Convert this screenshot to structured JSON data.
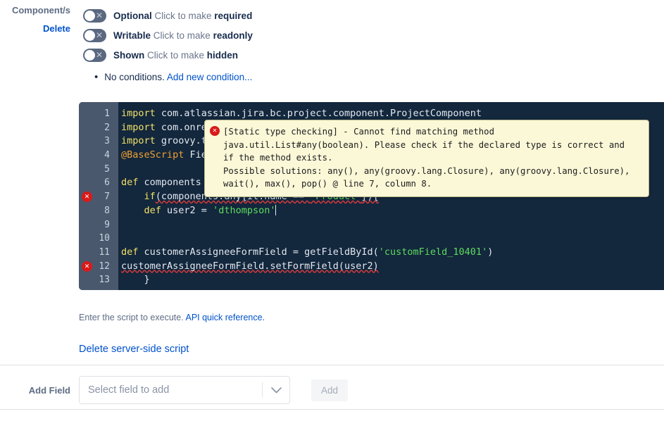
{
  "left_panel": {
    "field_label": "Component/s",
    "delete_link": "Delete"
  },
  "toggles": [
    {
      "state": "Optional",
      "hint_prefix": "Click to make ",
      "hint_target": "required",
      "icon": "toggle-off-icon",
      "name": "required-toggle"
    },
    {
      "state": "Writable",
      "hint_prefix": "Click to make ",
      "hint_target": "readonly",
      "icon": "toggle-off-icon",
      "name": "readonly-toggle"
    },
    {
      "state": "Shown",
      "hint_prefix": "Click to make ",
      "hint_target": "hidden",
      "icon": "toggle-off-icon",
      "name": "hidden-toggle"
    }
  ],
  "conditions": {
    "bullet": "•",
    "text": "No conditions.",
    "link": "Add new condition..."
  },
  "editor": {
    "lines": [
      {
        "number": "1",
        "error": false,
        "segments": [
          {
            "t": "import",
            "c": "kw"
          },
          {
            "t": " com.atlassian.jira.bc.project.component.ProjectComponent",
            "c": "plain"
          }
        ]
      },
      {
        "number": "2",
        "error": false,
        "segments": [
          {
            "t": "import",
            "c": "kw"
          },
          {
            "t": " com.onres",
            "c": "plain"
          }
        ]
      },
      {
        "number": "3",
        "error": false,
        "segments": [
          {
            "t": "import",
            "c": "kw"
          },
          {
            "t": " groovy.tr",
            "c": "plain"
          }
        ]
      },
      {
        "number": "4",
        "error": false,
        "segments": [
          {
            "t": "@BaseScript",
            "c": "ann"
          },
          {
            "t": " Fie",
            "c": "plain"
          }
        ]
      },
      {
        "number": "5",
        "error": false,
        "segments": []
      },
      {
        "number": "6",
        "error": false,
        "segments": [
          {
            "t": "def",
            "c": "kw"
          },
          {
            "t": " components ",
            "c": "plain"
          }
        ]
      },
      {
        "number": "7",
        "error": true,
        "segments": [
          {
            "t": "    ",
            "c": "plain"
          },
          {
            "t": "if",
            "c": "kw"
          },
          {
            "t": "(components.any{it.name == ",
            "c": "squig-plain"
          },
          {
            "t": "'Product'",
            "c": "squig-str"
          },
          {
            "t": "}){",
            "c": "squig-plain"
          }
        ]
      },
      {
        "number": "8",
        "error": false,
        "segments": [
          {
            "t": "    ",
            "c": "plain"
          },
          {
            "t": "def",
            "c": "kw"
          },
          {
            "t": " user2 = ",
            "c": "plain"
          },
          {
            "t": "'dthompson'",
            "c": "str"
          },
          {
            "t": "|",
            "c": "caret"
          }
        ]
      },
      {
        "number": "9",
        "error": false,
        "segments": []
      },
      {
        "number": "10",
        "error": false,
        "segments": []
      },
      {
        "number": "11",
        "error": false,
        "segments": [
          {
            "t": "def",
            "c": "kw"
          },
          {
            "t": " customerAssigneeFormField = getFieldById(",
            "c": "plain"
          },
          {
            "t": "'customField_10401'",
            "c": "str"
          },
          {
            "t": ")",
            "c": "plain"
          }
        ]
      },
      {
        "number": "12",
        "error": true,
        "segments": [
          {
            "t": "customerAssigneeFormField.setFormField(user2)",
            "c": "squig-plain"
          }
        ]
      },
      {
        "number": "13",
        "error": false,
        "segments": [
          {
            "t": "    }",
            "c": "plain"
          }
        ]
      }
    ],
    "error_marker_icon": "error-circle-icon"
  },
  "error_tooltip": {
    "icon": "error-circle-icon",
    "lines": [
      "[Static type checking] - Cannot find matching method",
      "java.util.List#any(boolean). Please check if the declared type is correct and",
      "if the method exists.",
      "Possible solutions: any(), any(groovy.lang.Closure), any(groovy.lang.Closure),",
      "wait(), max(), pop() @ line 7, column 8."
    ]
  },
  "script_hint": {
    "text": "Enter the script to execute. ",
    "link": "API quick reference."
  },
  "delete_script_link": "Delete server-side script",
  "add_field": {
    "label": "Add Field",
    "select_placeholder": "Select field to add",
    "select_value": "",
    "dropdown_icon": "chevron-down-icon",
    "button_label": "Add"
  },
  "colors": {
    "link": "#0052cc",
    "label": "#5e6c84",
    "editor_bg": "#13273d",
    "gutter_bg": "#4a586d",
    "tooltip_bg": "#fbf8d8",
    "error_red": "#d91a1a",
    "keyword": "#f2e267",
    "annotation": "#f0a132",
    "string": "#5ddc5d"
  }
}
